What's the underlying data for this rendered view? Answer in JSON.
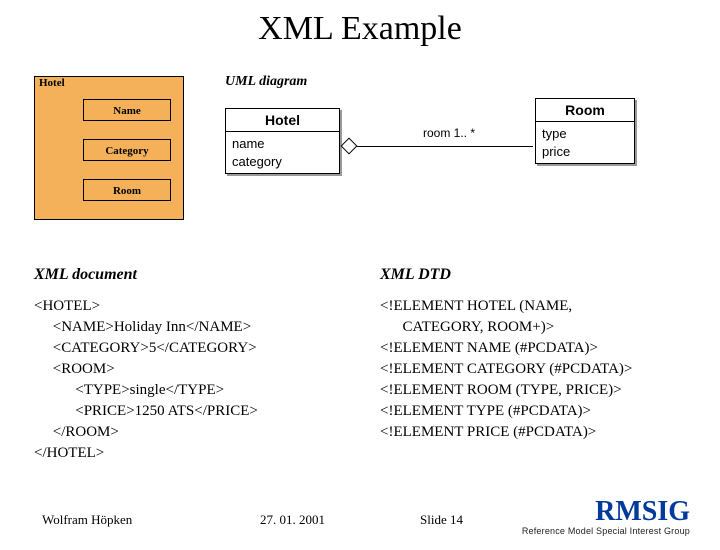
{
  "title": "XML Example",
  "uml_label": "UML diagram",
  "hierarchy": {
    "root": "Hotel",
    "children": [
      "Name",
      "Category",
      "Room"
    ]
  },
  "uml": {
    "hotel": {
      "name": "Hotel",
      "attrs": "name\ncategory"
    },
    "room": {
      "name": "Room",
      "attrs": "type\nprice"
    },
    "assoc": {
      "label": "room  1.. *"
    }
  },
  "sections": {
    "xml_doc": "XML document",
    "xml_dtd": "XML DTD"
  },
  "xml_doc_code": "<HOTEL>\n     <NAME>Holiday Inn</NAME>\n     <CATEGORY>5</CATEGORY>\n     <ROOM>\n           <TYPE>single</TYPE>\n           <PRICE>1250 ATS</PRICE>\n     </ROOM>\n</HOTEL>",
  "xml_dtd_code": "<!ELEMENT HOTEL (NAME,\n      CATEGORY, ROOM+)>\n<!ELEMENT NAME (#PCDATA)>\n<!ELEMENT CATEGORY (#PCDATA)>\n<!ELEMENT ROOM (TYPE, PRICE)>\n<!ELEMENT TYPE (#PCDATA)>\n<!ELEMENT PRICE (#PCDATA)>",
  "footer": {
    "author": "Wolfram Höpken",
    "date": "27. 01. 2001",
    "slide": "Slide 14",
    "logo": "RMSIG",
    "tagline": "Reference Model Special Interest Group"
  }
}
